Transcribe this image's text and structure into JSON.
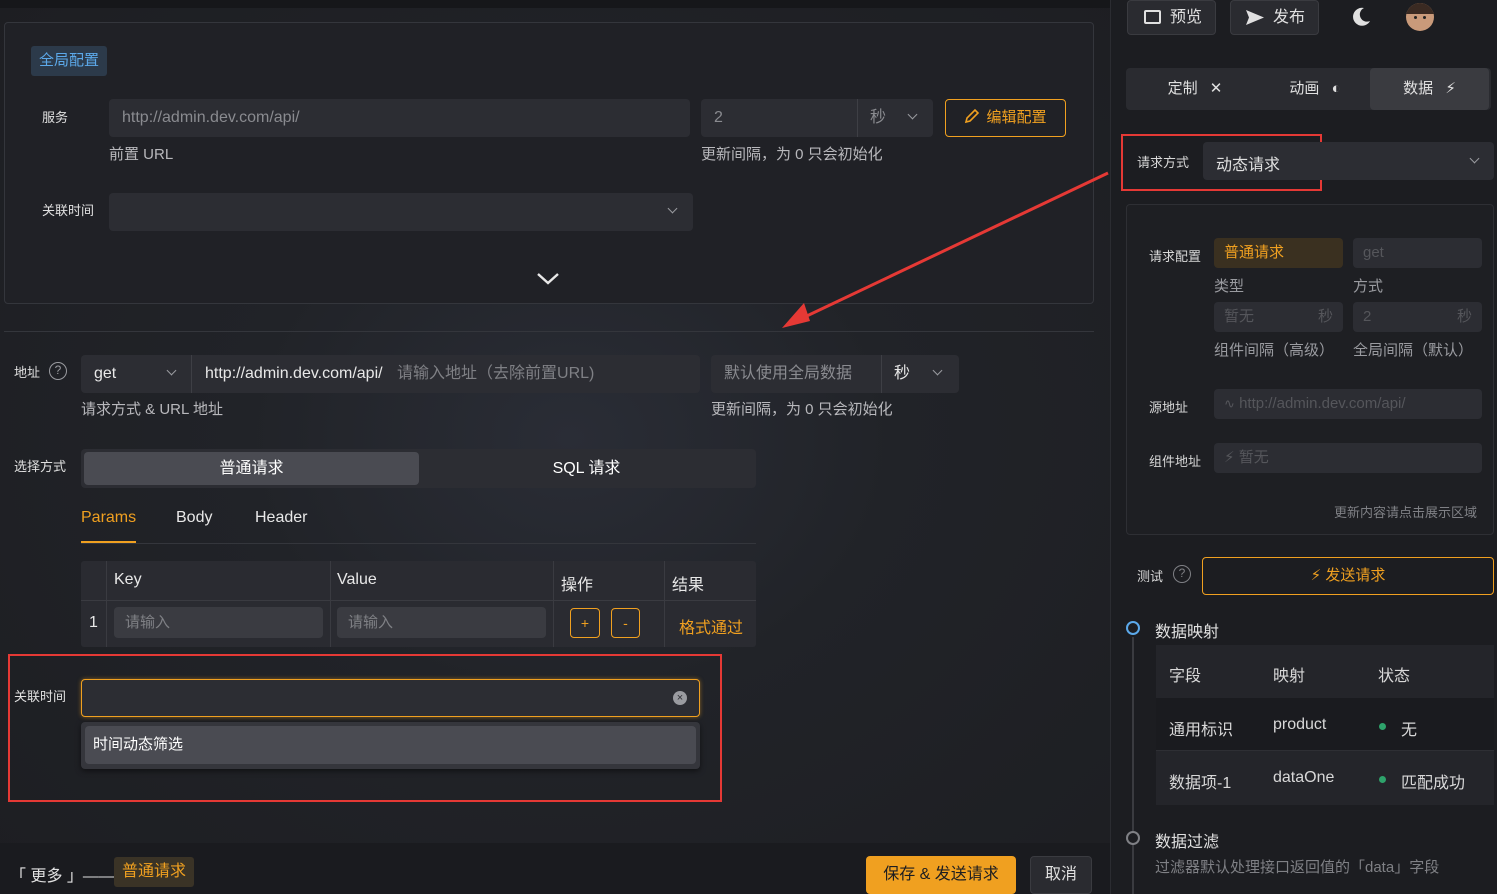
{
  "colors": {
    "accent": "#f0a020",
    "blue": "#5ca9ea",
    "red_highlight": "#e53935",
    "success": "#2ea36b"
  },
  "global": {
    "tag": "全局配置",
    "service_label": "服务",
    "service_url": "http://admin.dev.com/api/",
    "service_sub": "前置 URL",
    "interval_value": "2",
    "interval_unit": "秒",
    "interval_sub": "更新间隔，为 0 只会初始化",
    "edit_button": "编辑配置",
    "related_time_label": "关联时间"
  },
  "request": {
    "address_label": "地址",
    "method": "get",
    "base_url": "http://admin.dev.com/api/",
    "path_placeholder": "请输入地址（去除前置URL)",
    "address_sub": "请求方式 & URL 地址",
    "interval_placeholder": "默认使用全局数据",
    "interval_unit": "秒",
    "interval_sub": "更新间隔，为 0 只会初始化",
    "select_label": "选择方式",
    "modes": [
      "普通请求",
      "SQL 请求"
    ],
    "tabs": [
      "Params",
      "Body",
      "Header"
    ],
    "table_headers": [
      "Key",
      "Value",
      "操作",
      "结果"
    ],
    "row_index": "1",
    "key_placeholder": "请输入",
    "value_placeholder": "请输入",
    "add_btn": "+",
    "remove_btn": "-",
    "result": "格式通过",
    "related_time_label": "关联时间",
    "dropdown_option": "时间动态筛选"
  },
  "footer": {
    "more": "「 更多 」——",
    "tag": "普通请求",
    "save": "保存 & 发送请求",
    "cancel": "取消"
  },
  "right": {
    "preview": "预览",
    "publish": "发布",
    "tabs": [
      "定制",
      "动画",
      "数据"
    ],
    "request_method_label": "请求方式",
    "request_method_value": "动态请求",
    "config_label": "请求配置",
    "type_value": "普通请求",
    "type_sub": "类型",
    "method_value": "get",
    "method_sub": "方式",
    "comp_interval": "暂无",
    "comp_interval_unit": "秒",
    "comp_interval_sub": "组件间隔（高级）",
    "global_interval": "2",
    "global_interval_unit": "秒",
    "global_interval_sub": "全局间隔（默认）",
    "source_label": "源地址",
    "source_value": "http://admin.dev.com/api/",
    "comp_addr_label": "组件地址",
    "comp_addr_value": "暂无",
    "hint": "更新内容请点击展示区域",
    "test_label": "测试",
    "send_button": "发送请求",
    "mapping_title": "数据映射",
    "mapping_headers": [
      "字段",
      "映射",
      "状态"
    ],
    "mapping_rows": [
      {
        "field": "通用标识",
        "map": "product",
        "status": "无"
      },
      {
        "field": "数据项-1",
        "map": "dataOne",
        "status": "匹配成功"
      }
    ],
    "filter_title": "数据过滤",
    "filter_desc": "过滤器默认处理接口返回值的「data」字段"
  }
}
